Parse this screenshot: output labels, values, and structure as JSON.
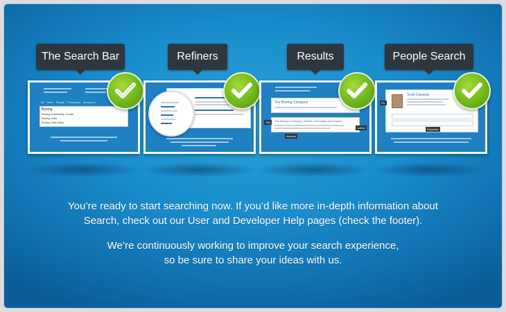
{
  "steps": [
    {
      "label": "The Search Bar",
      "icon": "checkmark-icon",
      "search_query": "Boeing",
      "suggestions": [
        "Boeing Leadership Center",
        "Boeing Jobs",
        "Boeing Help Desk"
      ],
      "tabs": [
        "All Sites",
        "People",
        "Processes",
        "Advanced"
      ]
    },
    {
      "label": "Refiners",
      "icon": "checkmark-icon"
    },
    {
      "label": "Results",
      "icon": "checkmark-icon",
      "result_title": "The Boeing Company | Stories | Innovation and Impact",
      "first_result": "The Boeing Company",
      "tags": [
        "Title",
        "Author",
        "Authors"
      ]
    },
    {
      "label": "People Search",
      "icon": "checkmark-icon",
      "person_name": "Scott Cassady",
      "tags": [
        "Pic",
        "Expertise"
      ]
    }
  ],
  "message": {
    "paragraph1_line1": "You’re ready to start searching now. If you’d like more in-depth information about",
    "paragraph1_line2": "Search, check out our User and Developer Help pages (check the footer).",
    "paragraph2_line1": "We’re continuously working to improve your search experience,",
    "paragraph2_line2": "so be sure to share your ideas with us."
  },
  "colors": {
    "background_blue": "#1a8ccc",
    "label_bg": "#2e3640",
    "check_green": "#6fb71b"
  }
}
